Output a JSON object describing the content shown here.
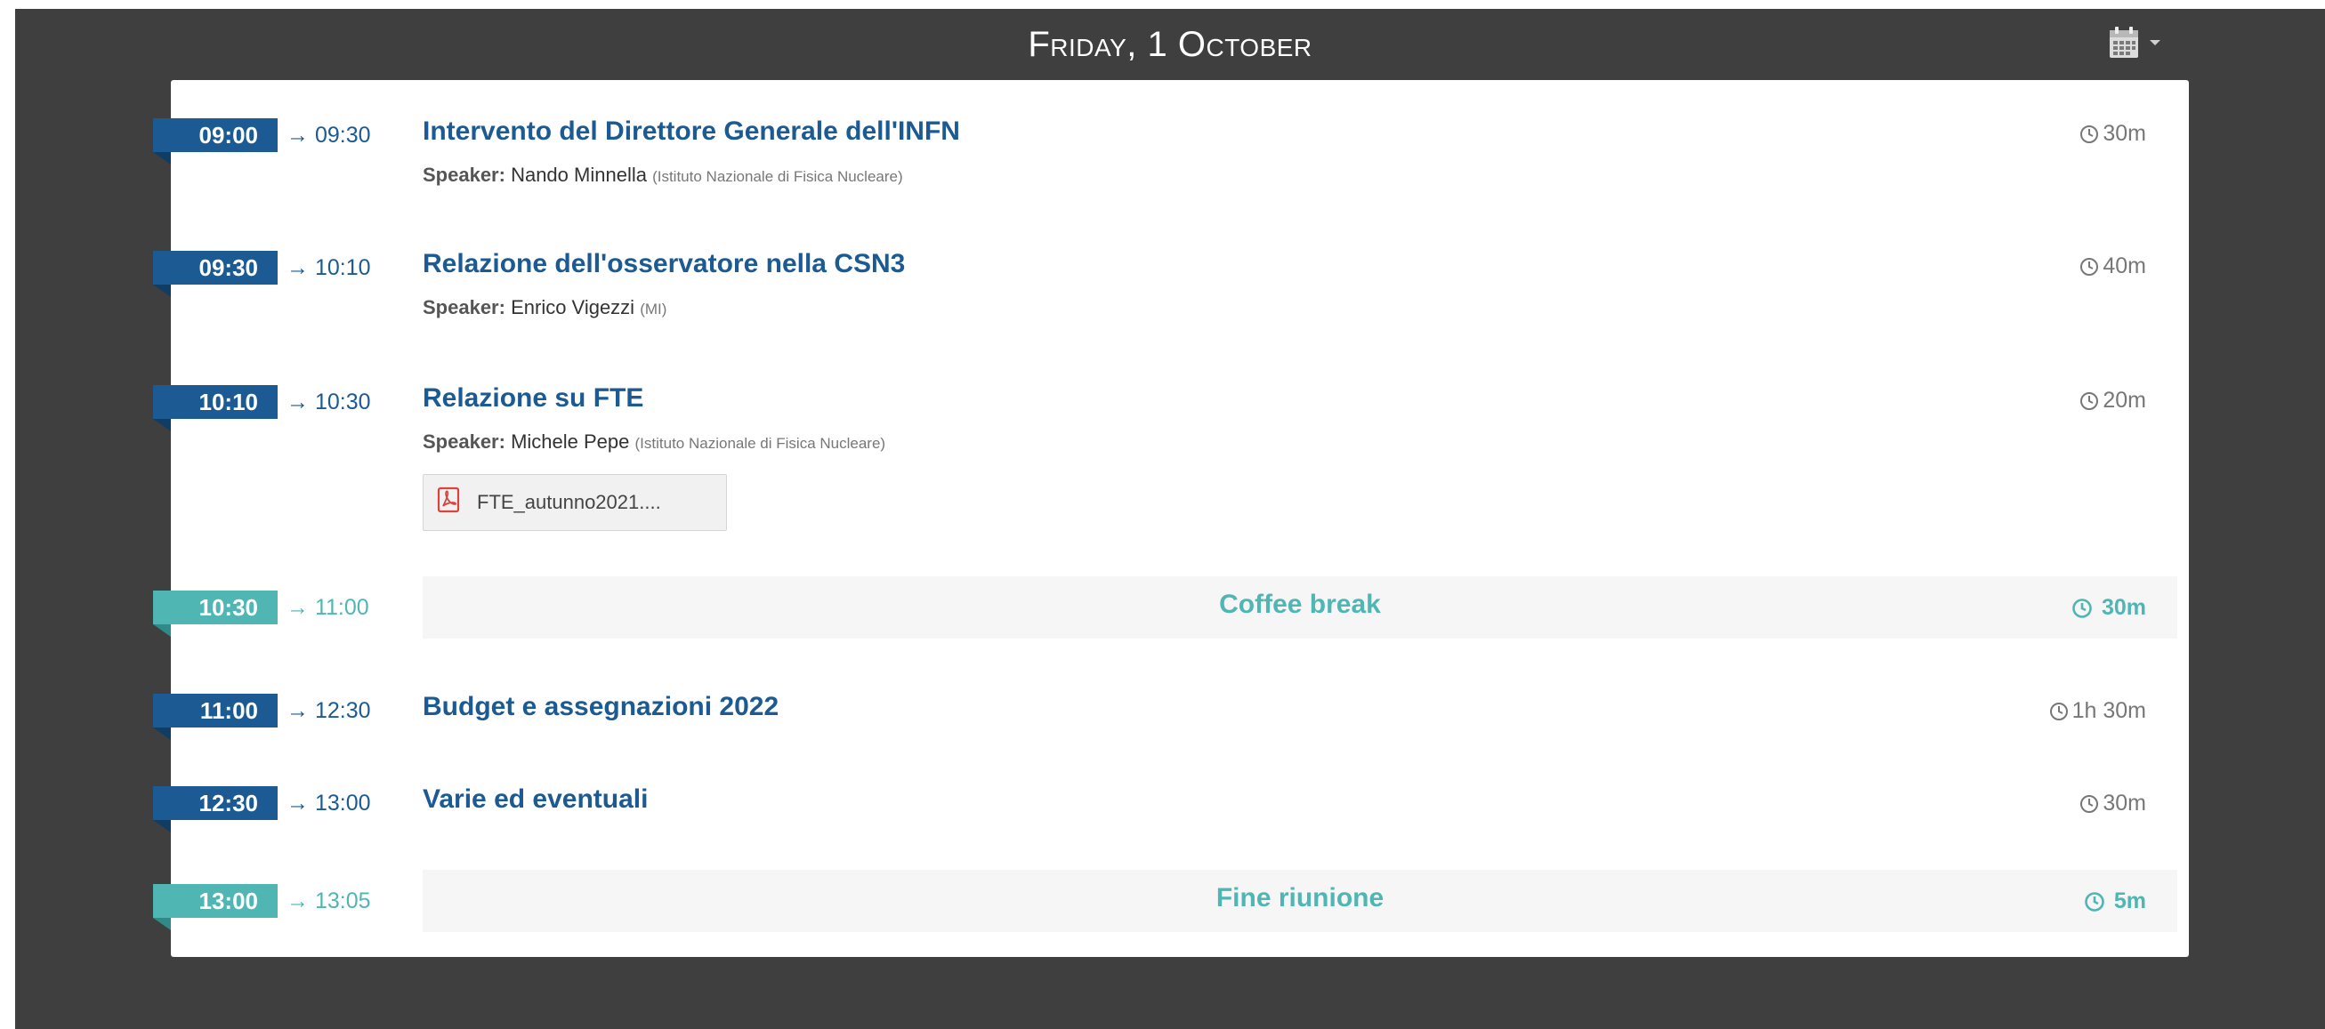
{
  "header": {
    "day_title": "Friday, 1 October",
    "calendar_icon": "calendar-icon",
    "dropdown_icon": "caret-down-icon"
  },
  "entries": [
    {
      "type": "contribution",
      "start": "09:00",
      "end": "→ 09:30",
      "title": "Intervento del Direttore Generale dell'INFN",
      "speaker_label": "Speaker:",
      "speaker_name": "Nando Minnella",
      "speaker_affiliation": "(Istituto Nazionale di Fisica Nucleare)",
      "duration": "30m"
    },
    {
      "type": "contribution",
      "start": "09:30",
      "end": "→ 10:10",
      "title": "Relazione dell'osservatore nella CSN3",
      "speaker_label": "Speaker:",
      "speaker_name": "Enrico Vigezzi",
      "speaker_affiliation": "(MI)",
      "duration": "40m"
    },
    {
      "type": "contribution",
      "start": "10:10",
      "end": "→ 10:30",
      "title": "Relazione su FTE",
      "speaker_label": "Speaker:",
      "speaker_name": "Michele Pepe",
      "speaker_affiliation": "(Istituto Nazionale di Fisica Nucleare)",
      "duration": "20m",
      "attachment": "FTE_autunno2021...."
    },
    {
      "type": "break",
      "start": "10:30",
      "end": "→ 11:00",
      "title": "Coffee break",
      "duration": "30m"
    },
    {
      "type": "contribution",
      "start": "11:00",
      "end": "→ 12:30",
      "title": "Budget e assegnazioni 2022",
      "duration": "1h 30m"
    },
    {
      "type": "contribution",
      "start": "12:30",
      "end": "→ 13:00",
      "title": "Varie ed eventuali",
      "duration": "30m"
    },
    {
      "type": "break",
      "start": "13:00",
      "end": "→ 13:05",
      "title": "Fine riunione",
      "duration": "5m"
    }
  ],
  "colors": {
    "background": "#3f3f3f",
    "contribution_accent": "#1b5a93",
    "break_accent": "#4fb6b3",
    "pdf_icon": "#d9453c"
  }
}
